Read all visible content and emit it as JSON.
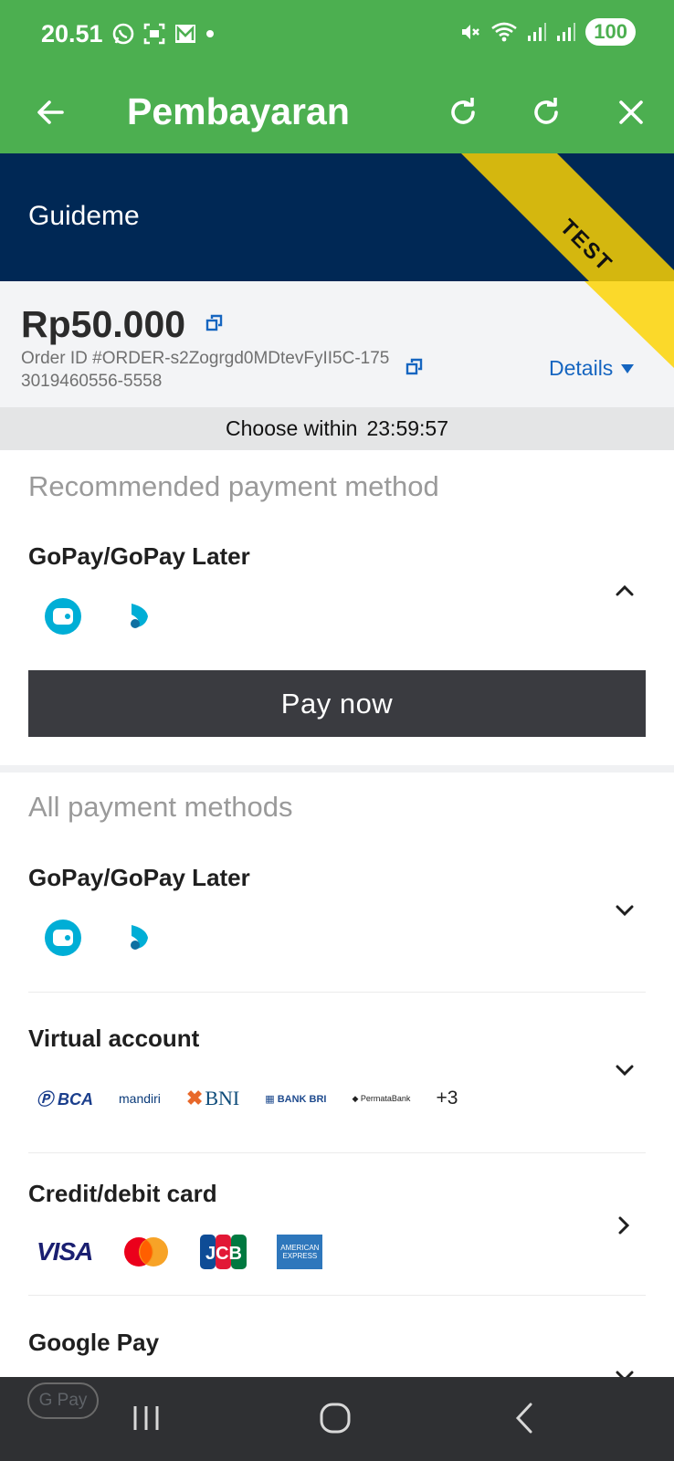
{
  "status_bar": {
    "time": "20.51",
    "battery": "100"
  },
  "app_bar": {
    "title": "Pembayaran",
    "icons": [
      "arrow-back-icon",
      "refresh-icon",
      "refresh-icon",
      "close-icon"
    ]
  },
  "merchant": {
    "name": "Guideme",
    "ribbon": "TEST"
  },
  "summary": {
    "amount": "Rp50.000",
    "order_id": "Order ID #ORDER-s2Zogrgd0MDtevFyII5C-1753019460556-5558",
    "details_label": "Details"
  },
  "timer": {
    "label": "Choose within",
    "value": "23:59:57"
  },
  "recommended": {
    "section_title": "Recommended payment method",
    "method_title": "GoPay/GoPay Later",
    "pay_button": "Pay now"
  },
  "all_methods": {
    "section_title": "All payment methods",
    "items": [
      {
        "title": "GoPay/GoPay Later"
      },
      {
        "title": "Virtual account",
        "banks": [
          "BCA",
          "mandiri",
          "BNI",
          "BANK BRI",
          "PermataBank"
        ],
        "more": "+3"
      },
      {
        "title": "Credit/debit card",
        "cards": [
          "VISA",
          "mastercard",
          "JCB",
          "AMERICAN EXPRESS"
        ]
      },
      {
        "title": "Google Pay",
        "badge": "G Pay"
      }
    ]
  },
  "colors": {
    "app_bar": "#4caf50",
    "merchant_bg": "#002855",
    "link": "#1565c0",
    "pay_button": "#3a3b40",
    "gopay": "#00aed6"
  }
}
